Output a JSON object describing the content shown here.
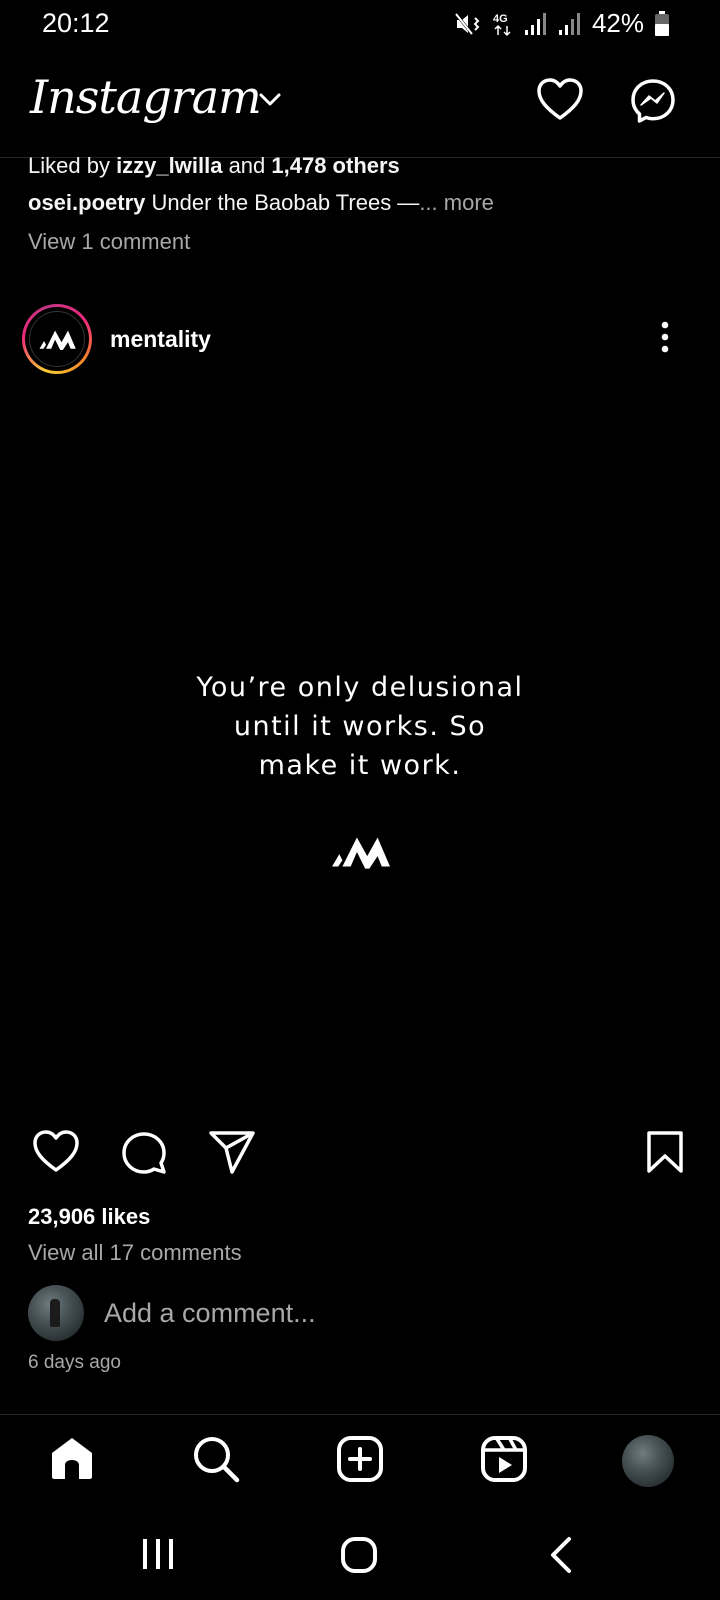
{
  "status_bar": {
    "time": "20:12",
    "network": "4G",
    "battery": "42%",
    "icons": [
      "mute-vibrate-icon",
      "4g-icon",
      "signal-icon",
      "signal-icon",
      "battery-icon"
    ]
  },
  "header": {
    "title": "Instagram",
    "icons": [
      "chevron-down-icon",
      "heart-icon",
      "messenger-icon"
    ]
  },
  "previous_post": {
    "liked_prefix": "Liked by ",
    "liked_user": "izzy_lwilla",
    "liked_and": " and ",
    "liked_others": "1,478 others",
    "caption_user": "osei.poetry",
    "caption_text": " Under the Baobab Trees —",
    "caption_more": "... more",
    "view_comments": "View 1 comment"
  },
  "post": {
    "username": "mentality",
    "quote_lines": [
      "You’re only delusional",
      "until it works. So",
      "make it work."
    ],
    "likes": "23,906 likes",
    "view_all_comments": "View all 17 comments",
    "add_comment_placeholder": "Add a comment...",
    "timestamp": "6 days ago"
  },
  "colors": {
    "background": "#000000",
    "text": "#f5f5f5",
    "muted": "#a8a8a8",
    "divider": "#262626"
  },
  "bottom_nav": [
    "home-icon",
    "search-icon",
    "create-icon",
    "reels-icon",
    "profile-avatar"
  ],
  "system_nav": [
    "recents-icon",
    "home-button-icon",
    "back-icon"
  ]
}
